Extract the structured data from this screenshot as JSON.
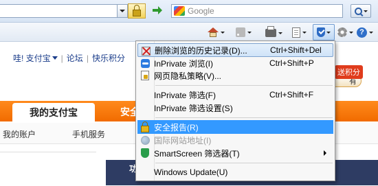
{
  "address_bar": {
    "search_placeholder": "Google"
  },
  "icons": {
    "lock": "lock-icon",
    "go": "go-arrow-icon",
    "search": "search-icon",
    "home": "home-icon",
    "feeds": "rss-icon",
    "print": "printer-icon",
    "page": "page-icon",
    "safety": "safety-shield-icon",
    "tools": "gear-icon",
    "help": "help-icon"
  },
  "colors": {
    "nav_orange": "#f16b00",
    "menu_highlight": "#3399ff",
    "link_blue": "#1a3c8a"
  },
  "page": {
    "top_links": [
      "哇! 支付宝",
      "论坛",
      "快乐积分"
    ],
    "promo_badge": "送积分",
    "promo_button": "有",
    "nav_tabs": [
      "我的支付宝",
      "安全"
    ],
    "sub_nav": [
      "我的账户",
      "手机服务"
    ],
    "panel_title": "功"
  },
  "safety_menu": {
    "items": [
      {
        "label": "删除浏览的历史记录(D)...",
        "shortcut": "Ctrl+Shift+Del",
        "icon": "delete-history-icon"
      },
      {
        "label": "InPrivate 浏览(I)",
        "shortcut": "Ctrl+Shift+P",
        "icon": "inprivate-icon"
      },
      {
        "label": "网页隐私策略(V)...",
        "shortcut": "",
        "icon": "privacy-policy-icon"
      },
      {
        "label": "InPrivate 筛选(F)",
        "shortcut": "Ctrl+Shift+F",
        "icon": ""
      },
      {
        "label": "InPrivate 筛选设置(S)",
        "shortcut": "",
        "icon": ""
      },
      {
        "label": "安全报告(R)",
        "shortcut": "",
        "icon": "security-report-lock-icon"
      },
      {
        "label": "国际网站地址(I)",
        "shortcut": "",
        "icon": "international-address-icon"
      },
      {
        "label": "SmartScreen 筛选器(T)",
        "shortcut": "",
        "icon": "smartscreen-icon"
      },
      {
        "label": "Windows Update(U)",
        "shortcut": "",
        "icon": ""
      }
    ]
  }
}
